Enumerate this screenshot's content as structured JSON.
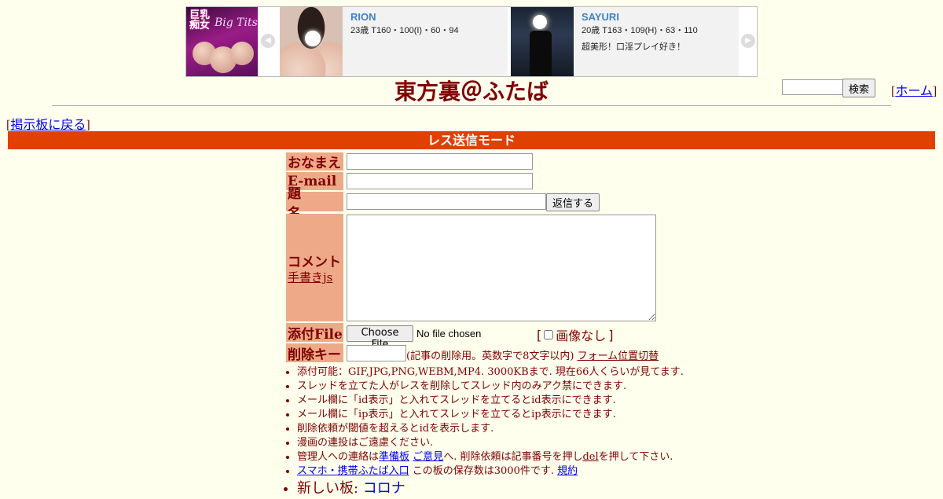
{
  "banner": {
    "promo_text_1": "巨乳痴女",
    "promo_text_2": "Big Tits",
    "left_arrow": "◀",
    "right_arrow": "▶",
    "cards": [
      {
        "name": "RION",
        "spec": "23歳 T160・100(I)・60・94",
        "desc": ""
      },
      {
        "name": "SAYURI",
        "spec": "20歳 T163・109(H)・63・110",
        "desc": "超美形！口淫プレイ好き！"
      }
    ]
  },
  "header": {
    "title": "東方裏＠ふたば",
    "search_button": "検索",
    "home_open": "[",
    "home_link": "ホーム",
    "home_close": "]"
  },
  "back": {
    "open": "[",
    "link": "掲示板に戻る",
    "close": "]"
  },
  "mode_bar": "レス送信モード",
  "form": {
    "name_label": "おなまえ",
    "email_label": "E-mail",
    "subject_label": "題　名",
    "submit_button": "返信する",
    "comment_label": "コメント",
    "handwriting_link": "手書きjs",
    "file_label": "添付File",
    "choose_file_button": "Choose File",
    "no_file_text": "No file chosen",
    "no_image_open": "[",
    "no_image_label": "画像なし",
    "no_image_close": "]",
    "delete_key_label": "削除キー",
    "delete_key_note": "(記事の削除用。英数字で8文字以内)",
    "form_switch_link": "フォーム位置切替"
  },
  "rules": {
    "r1": "添付可能：GIF,JPG,PNG,WEBM,MP4. 3000KBまで. 現在66人くらいが見てます.",
    "r2": "スレッドを立てた人がレスを削除してスレッド内のみアク禁にできます.",
    "r3": "メール欄に「id表示」と入れてスレッドを立てるとid表示にできます.",
    "r4": "メール欄に「ip表示」と入れてスレッドを立てるとip表示にできます.",
    "r5": "削除依頼が閾値を超えるとidを表示します.",
    "r6": "漫画の連投はご遠慮ください.",
    "r7_a": "管理人への連絡は",
    "r7_link1": "準備板",
    "r7_link2": "ご意見",
    "r7_b": "へ. 削除依頼は記事番号を押し",
    "r7_del": "del",
    "r7_c": "を押して下さい.",
    "r8_link": "スマホ・携帯ふたば入口",
    "r8_text": " この板の保存数は3000件です.",
    "r8_link2": "規約",
    "r9_text": "新しい板: ",
    "r9_link": "コロナ"
  }
}
